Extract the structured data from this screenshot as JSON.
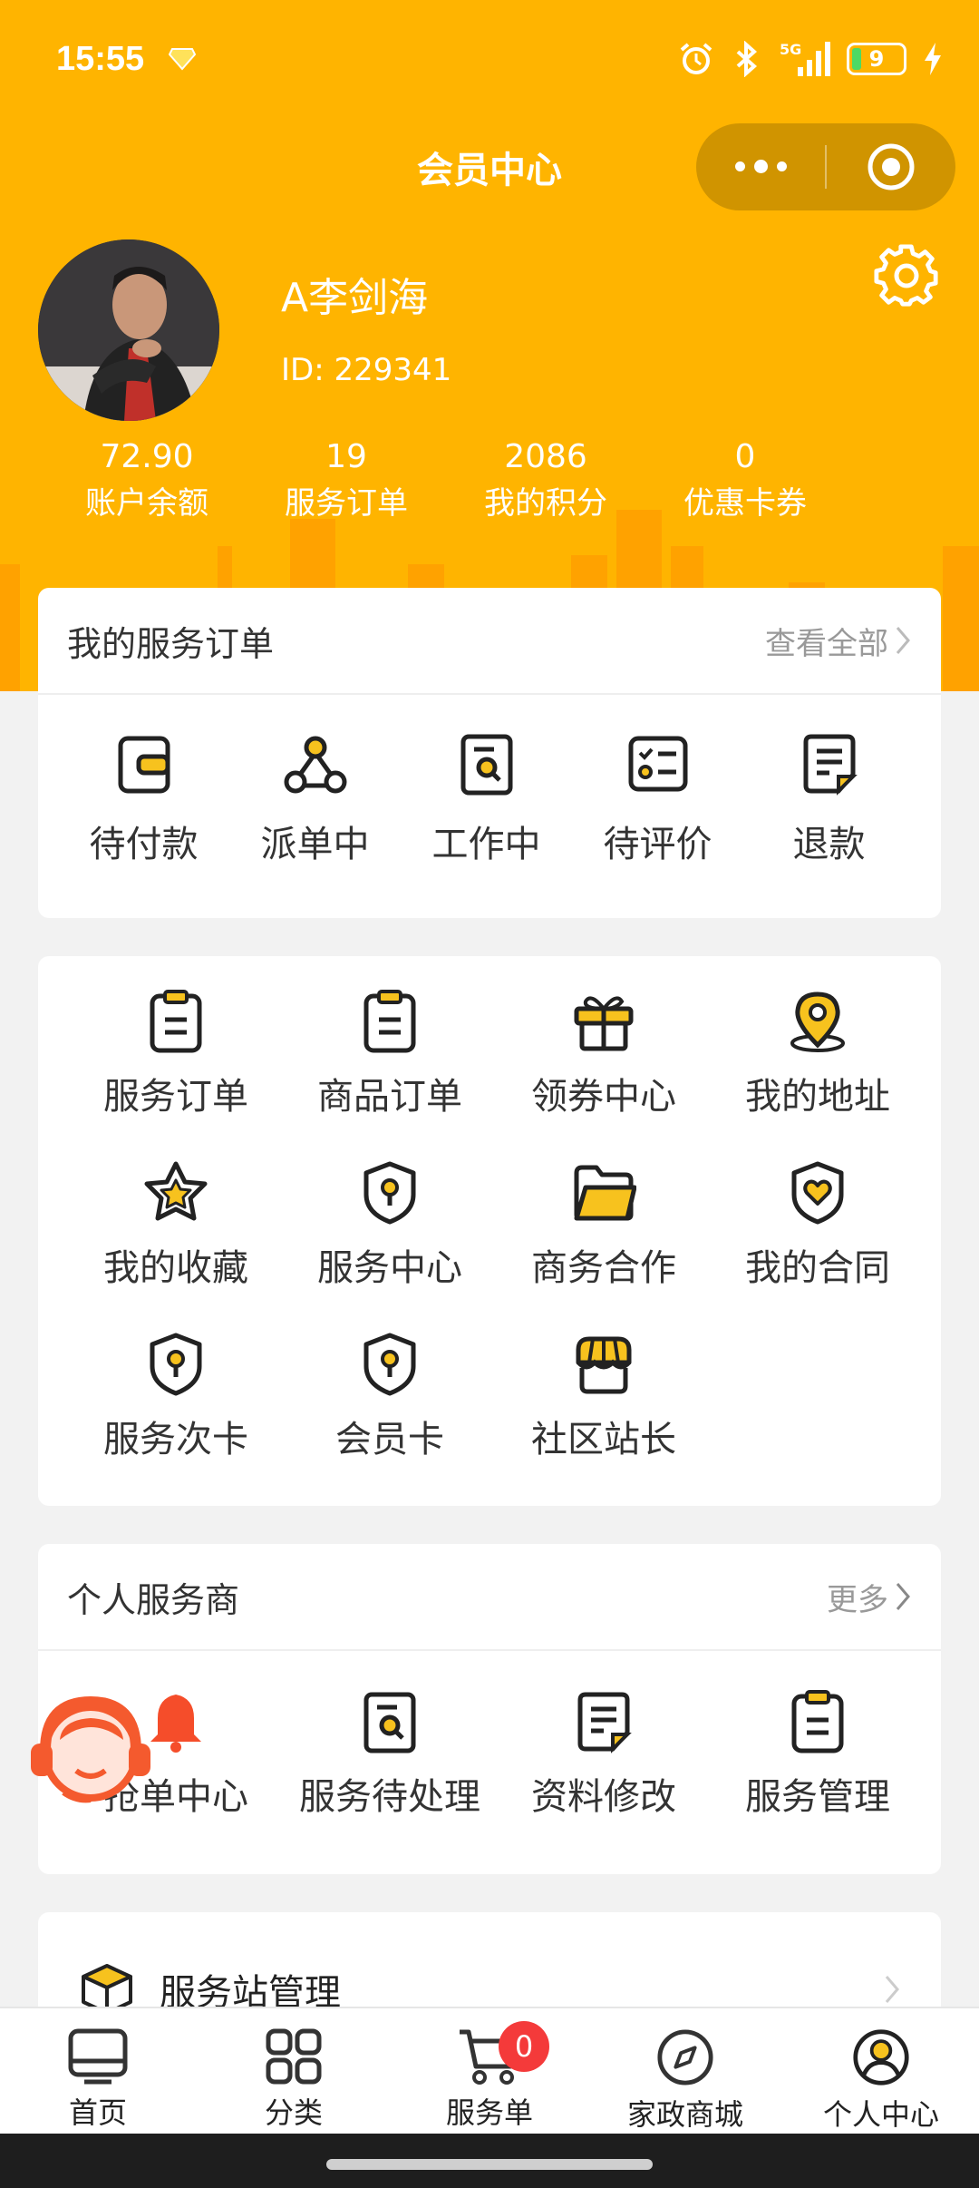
{
  "status_bar": {
    "time": "15:55",
    "battery": "9",
    "network": "5G"
  },
  "nav": {
    "title": "会员中心"
  },
  "user": {
    "name": "A李剑海",
    "id": "ID: 229341"
  },
  "stats": [
    {
      "value": "72.90",
      "label": "账户余额"
    },
    {
      "value": "19",
      "label": "服务订单"
    },
    {
      "value": "2086",
      "label": "我的积分"
    },
    {
      "value": "0",
      "label": "优惠卡券"
    }
  ],
  "my_orders": {
    "title": "我的服务订单",
    "link": "查看全部",
    "items": [
      {
        "label": "待付款",
        "icon": "wallet-icon"
      },
      {
        "label": "派单中",
        "icon": "dispatch-icon"
      },
      {
        "label": "工作中",
        "icon": "search-doc-icon"
      },
      {
        "label": "待评价",
        "icon": "checklist-icon"
      },
      {
        "label": "退款",
        "icon": "refund-doc-icon"
      }
    ]
  },
  "services": {
    "items": [
      {
        "label": "服务订单",
        "icon": "clipboard-icon"
      },
      {
        "label": "商品订单",
        "icon": "clipboard-icon"
      },
      {
        "label": "领券中心",
        "icon": "gift-icon"
      },
      {
        "label": "我的地址",
        "icon": "location-pin-icon"
      },
      {
        "label": "我的收藏",
        "icon": "star-icon"
      },
      {
        "label": "服务中心",
        "icon": "shield-pin-icon"
      },
      {
        "label": "商务合作",
        "icon": "folder-icon"
      },
      {
        "label": "我的合同",
        "icon": "shield-heart-icon"
      },
      {
        "label": "服务次卡",
        "icon": "shield-pin-icon"
      },
      {
        "label": "会员卡",
        "icon": "shield-pin-icon"
      },
      {
        "label": "社区站长",
        "icon": "store-icon"
      }
    ]
  },
  "provider": {
    "title": "个人服务商",
    "link": "更多",
    "items": [
      {
        "label": "抢单中心",
        "icon": "bell-icon"
      },
      {
        "label": "服务待处理",
        "icon": "search-doc-icon"
      },
      {
        "label": "资料修改",
        "icon": "edit-doc-icon"
      },
      {
        "label": "服务管理",
        "icon": "clipboard-icon"
      }
    ]
  },
  "station": {
    "title": "服务站管理",
    "icon": "box-icon"
  },
  "tabbar": {
    "items": [
      {
        "label": "首页",
        "icon": "home-tv-icon"
      },
      {
        "label": "分类",
        "icon": "grid-icon"
      },
      {
        "label": "服务单",
        "icon": "cart-icon",
        "badge": "0"
      },
      {
        "label": "家政商城",
        "icon": "compass-icon"
      },
      {
        "label": "个人中心",
        "icon": "user-icon",
        "active": true
      }
    ]
  },
  "colors": {
    "brand": "#ffb400",
    "accent_icon": "#f7c21e",
    "badge": "#f43a3a"
  }
}
